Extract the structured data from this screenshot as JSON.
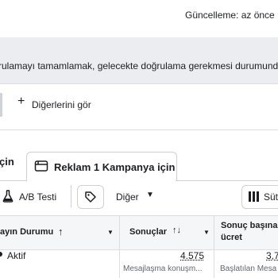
{
  "header": {
    "updated_label": "Güncelleme: az önce"
  },
  "banner": {
    "text": "rulamayı tamamlamak, gelecekte doğrulama gerekmesi durumunda"
  },
  "filters": {
    "see_others_label": "Diğerlerini gör"
  },
  "tabs": [
    {
      "label": "çin",
      "icon": "partial"
    },
    {
      "label": "Reklam 1 Kampanya için",
      "icon": "ad-icon"
    }
  ],
  "toolbar": {
    "ab_test_label": "A/B Testi",
    "tag_icon": "tag-icon",
    "other_label": "Diğer",
    "columns_label": "Süt"
  },
  "table": {
    "columns": [
      {
        "label": "ayın Durumu",
        "sort": "↑"
      },
      {
        "label": "Sonuçlar",
        "sort": "↑↓"
      },
      {
        "label_line1": "Sonuç başına",
        "label_line2": "ücret"
      }
    ],
    "rows": [
      {
        "status": "Aktif",
        "results_value": "4.575",
        "results_sub": "Mesajlaşma konuşm...",
        "cost_value": "3,7",
        "cost_sub": "Başlatılan Mesa"
      }
    ]
  }
}
